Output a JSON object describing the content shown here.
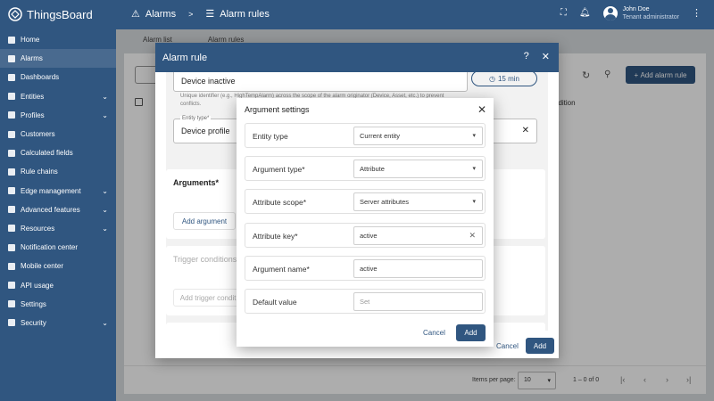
{
  "app": {
    "name": "ThingsBoard"
  },
  "breadcrumb": {
    "first": "Alarms",
    "separator": ">",
    "second": "Alarm rules"
  },
  "user": {
    "name": "John Doe",
    "role": "Tenant administrator"
  },
  "sidebar": {
    "items": [
      {
        "label": "Home",
        "icon": "home-icon",
        "chevron": false
      },
      {
        "label": "Alarms",
        "icon": "alarm-icon",
        "chevron": false
      },
      {
        "label": "Dashboards",
        "icon": "dashboard-icon",
        "chevron": false
      },
      {
        "label": "Entities",
        "icon": "entities-icon",
        "chevron": true
      },
      {
        "label": "Profiles",
        "icon": "profiles-icon",
        "chevron": true
      },
      {
        "label": "Customers",
        "icon": "customers-icon",
        "chevron": false
      },
      {
        "label": "Calculated fields",
        "icon": "calculated-fields-icon",
        "chevron": false
      },
      {
        "label": "Rule chains",
        "icon": "rule-chains-icon",
        "chevron": false
      },
      {
        "label": "Edge management",
        "icon": "edge-icon",
        "chevron": true
      },
      {
        "label": "Advanced features",
        "icon": "advanced-icon",
        "chevron": true
      },
      {
        "label": "Resources",
        "icon": "resources-icon",
        "chevron": true
      },
      {
        "label": "Notification center",
        "icon": "notification-icon",
        "chevron": false
      },
      {
        "label": "Mobile center",
        "icon": "mobile-icon",
        "chevron": false
      },
      {
        "label": "API usage",
        "icon": "api-icon",
        "chevron": false
      },
      {
        "label": "Settings",
        "icon": "settings-icon",
        "chevron": false
      },
      {
        "label": "Security",
        "icon": "security-icon",
        "chevron": true
      }
    ]
  },
  "tabs": {
    "list": "Alarm list",
    "rules": "Alarm rules"
  },
  "table": {
    "add_label": "Add alarm rule",
    "condition_header": "ndition"
  },
  "footer": {
    "items_per_page_label": "Items per page:",
    "items_per_page": "10",
    "range": "1 – 0 of 0"
  },
  "dialog": {
    "title": "Alarm rule",
    "name_value": "Device inactive",
    "timer": "15 min",
    "name_hint": "Unique identifier (e.g., HighTempAlarm) across the scope of the alarm originator (Device, Asset, etc.) to prevent conflicts.",
    "entity_type_label": "Entity type*",
    "entity_type_value": "Device profile",
    "arguments_title": "Arguments*",
    "add_argument": "Add argument",
    "trigger_title": "Trigger conditions",
    "add_trigger": "Add trigger conditi",
    "clear_partial": "Cl",
    "cancel": "Cancel",
    "add": "Add"
  },
  "argument_settings": {
    "title": "Argument settings",
    "rows": [
      {
        "label": "Entity type",
        "value": "Current entity",
        "type": "select"
      },
      {
        "label": "Argument type*",
        "value": "Attribute",
        "type": "select"
      },
      {
        "label": "Attribute scope*",
        "value": "Server attributes",
        "type": "select"
      },
      {
        "label": "Attribute key*",
        "value": "active",
        "type": "clearable"
      },
      {
        "label": "Argument name*",
        "value": "active",
        "type": "input"
      },
      {
        "label": "Default value",
        "placeholder": "Set",
        "type": "placeholder"
      }
    ],
    "cancel": "Cancel",
    "add": "Add"
  },
  "colors": {
    "primary": "#305680",
    "background": "#eef0f2"
  }
}
